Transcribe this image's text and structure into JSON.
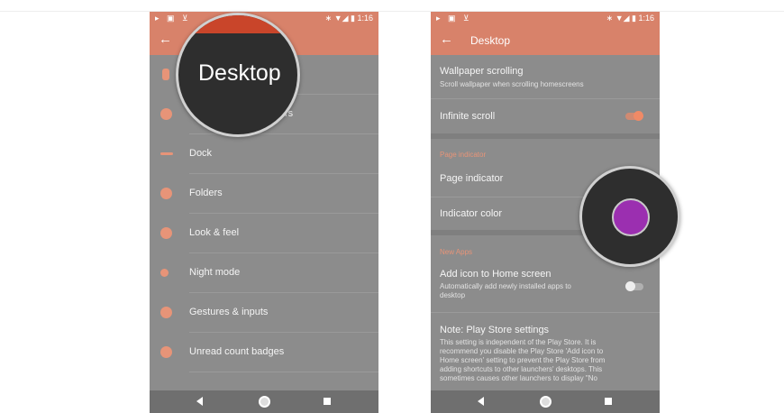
{
  "status": {
    "left_icons": "▸ ▣ ⊻",
    "right": "∗ ▼◢ ▮ 1:16"
  },
  "left_phone": {
    "menu": [
      {
        "label": "",
        "icon": "phone-icon",
        "color": "#e79478"
      },
      {
        "label": "rs",
        "icon": "emoji-icon",
        "color": "#e79478"
      },
      {
        "label": "Dock",
        "icon": "dock-icon",
        "color": "#e79478"
      },
      {
        "label": "Folders",
        "icon": "folder-icon",
        "color": "#e79478"
      },
      {
        "label": "Look & feel",
        "icon": "palette-icon",
        "color": "#e79478"
      },
      {
        "label": "Night mode",
        "icon": "moon-icon",
        "color": "#e79478"
      },
      {
        "label": "Gestures & inputs",
        "icon": "gesture-icon",
        "color": "#e79478"
      },
      {
        "label": "Unread count badges",
        "icon": "badge-icon",
        "color": "#e79478"
      }
    ],
    "magnifier_text": "Desktop"
  },
  "right_phone": {
    "title": "Desktop",
    "wallpaper_scrolling": {
      "title": "Wallpaper scrolling",
      "subtitle": "Scroll wallpaper when scrolling homescreens"
    },
    "infinite_scroll": {
      "title": "Infinite scroll",
      "enabled": true
    },
    "page_indicator_header": "Page indicator",
    "page_indicator": {
      "title": "Page indicator"
    },
    "indicator_color": {
      "title": "Indicator color",
      "color": "#9b2fb0"
    },
    "new_apps_header": "New Apps",
    "add_icon": {
      "title": "Add icon to Home screen",
      "subtitle_line1": "Automatically add newly installed apps to",
      "subtitle_line2": "desktop",
      "enabled": false
    },
    "note": {
      "title": "Note: Play Store settings",
      "lines": [
        "This setting is independent of the Play Store. It is",
        "recommend you disable the Play Store 'Add icon to",
        "Home screen' setting to prevent the Play Store from",
        "adding shortcuts to other launchers' desktops. This",
        "sometimes causes other launchers to display \"No"
      ]
    }
  },
  "colors": {
    "accent": "#d8826a",
    "icon": "#e79478",
    "background": "#8c8c8c"
  }
}
